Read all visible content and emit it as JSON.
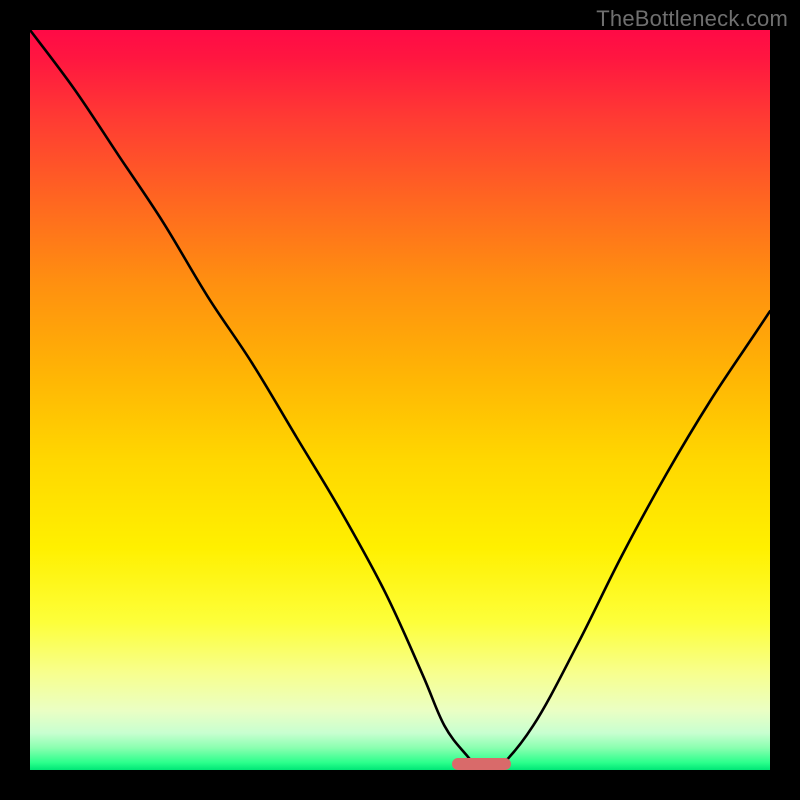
{
  "watermark": {
    "text": "TheBottleneck.com"
  },
  "chart_data": {
    "type": "line",
    "title": "",
    "xlabel": "",
    "ylabel": "",
    "xlim": [
      0,
      100
    ],
    "ylim": [
      0,
      100
    ],
    "background": "red-yellow-green vertical gradient (bottleneck severity)",
    "series": [
      {
        "name": "bottleneck-curve",
        "x": [
          0,
          6,
          12,
          18,
          24,
          30,
          36,
          42,
          48,
          53,
          56,
          59,
          61,
          63,
          68,
          74,
          80,
          86,
          92,
          98,
          100
        ],
        "y": [
          100,
          92,
          83,
          74,
          64,
          55,
          45,
          35,
          24,
          13,
          6,
          2,
          0,
          0,
          6,
          17,
          29,
          40,
          50,
          59,
          62
        ]
      }
    ],
    "marker": {
      "name": "optimal-range",
      "x_start": 57,
      "x_end": 65,
      "y": 0,
      "color": "#d96a6a"
    },
    "gradient_stops": [
      {
        "pos": 0,
        "color": "#ff0a46"
      },
      {
        "pos": 24,
        "color": "#ff6a1f"
      },
      {
        "pos": 58,
        "color": "#ffd700"
      },
      {
        "pos": 87,
        "color": "#f7ff8f"
      },
      {
        "pos": 99,
        "color": "#2bff8c"
      },
      {
        "pos": 100,
        "color": "#00e676"
      }
    ]
  }
}
